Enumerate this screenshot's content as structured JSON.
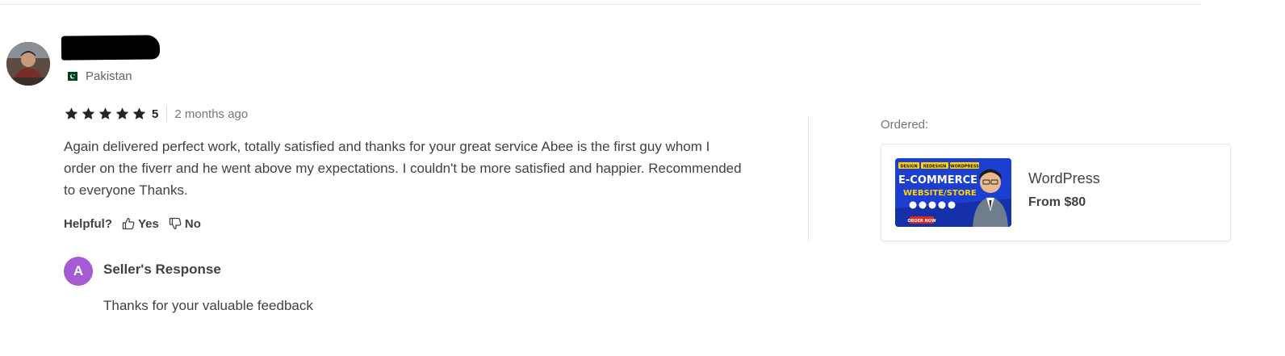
{
  "reviewer": {
    "country": "Pakistan",
    "rating": "5",
    "stars_filled": 5,
    "time_ago": "2 months ago"
  },
  "review": {
    "text": "Again delivered perfect work, totally satisfied and thanks for your great service Abee is the first guy whom I order on the fiverr and he went above my expectations. I couldn't be more satisfied and happier. Recommended to everyone Thanks."
  },
  "helpful": {
    "label": "Helpful?",
    "yes_label": "Yes",
    "no_label": "No"
  },
  "seller_response": {
    "avatar_letter": "A",
    "title": "Seller's Response",
    "text": "Thanks for your valuable feedback"
  },
  "ordered": {
    "label": "Ordered:",
    "gig_title": "WordPress",
    "gig_price": "From $80",
    "thumbnail": {
      "tags": [
        "DESIGN",
        "REDESIGN",
        "WORDPRESS"
      ],
      "headline": "E-COMMERCE",
      "subheadline": "WEBSITE/STORE",
      "cta": "ORDER NOW"
    }
  },
  "colors": {
    "star": "#222325",
    "seller_avatar": "#a55bd4",
    "thumb_blue": "#1c3fd1",
    "thumb_yellow": "#ffd400"
  }
}
